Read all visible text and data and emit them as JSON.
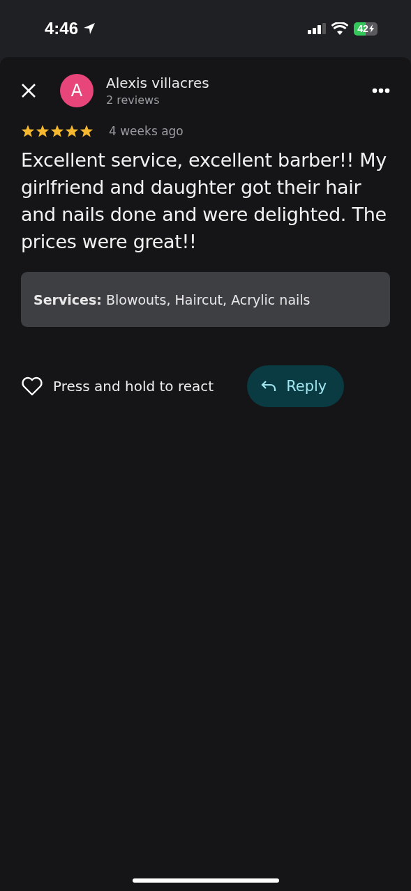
{
  "status_bar": {
    "time": "4:46",
    "battery": "42"
  },
  "review": {
    "avatar_letter": "A",
    "author": "Alexis villacres",
    "author_meta": "2 reviews",
    "stars": 5,
    "date": "4 weeks ago",
    "text": "Excellent service, excellent barber!! My girlfriend and daughter got their hair and nails done and were delighted. The prices were great!!",
    "services": "**Services:** Blowouts, Haircut, Acrylic nails"
  },
  "actions": {
    "react_label": "Press and hold to react",
    "reply_label": "Reply"
  }
}
